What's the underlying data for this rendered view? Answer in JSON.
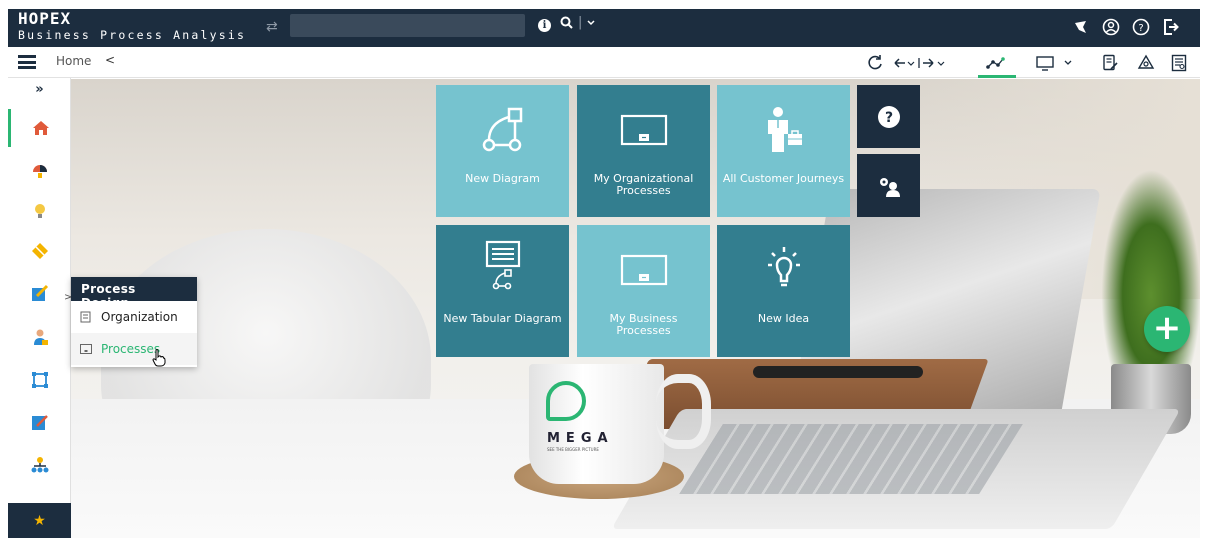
{
  "brand": {
    "logo": "HOPEX",
    "subtitle": "Business Process Analysis"
  },
  "search": {
    "value": "",
    "placeholder": ""
  },
  "breadcrumb": {
    "home": "Home"
  },
  "tiles": [
    {
      "label": "New Diagram"
    },
    {
      "label": "My Organizational Processes"
    },
    {
      "label": "All Customer Journeys"
    },
    {
      "label": "New Tabular Diagram"
    },
    {
      "label": "My Business Processes"
    },
    {
      "label": "New Idea"
    }
  ],
  "flyout": {
    "title": "Process Design",
    "items": [
      {
        "label": "Organization"
      },
      {
        "label": "Processes"
      }
    ]
  },
  "mug": {
    "brand": "MEGA",
    "tagline": "SEE THE BIGGER PICTURE"
  },
  "colors": {
    "navy": "#1c2d3f",
    "accent": "#2bb673",
    "tile_light": "#76c3cf",
    "tile_dark": "#337e8f"
  }
}
